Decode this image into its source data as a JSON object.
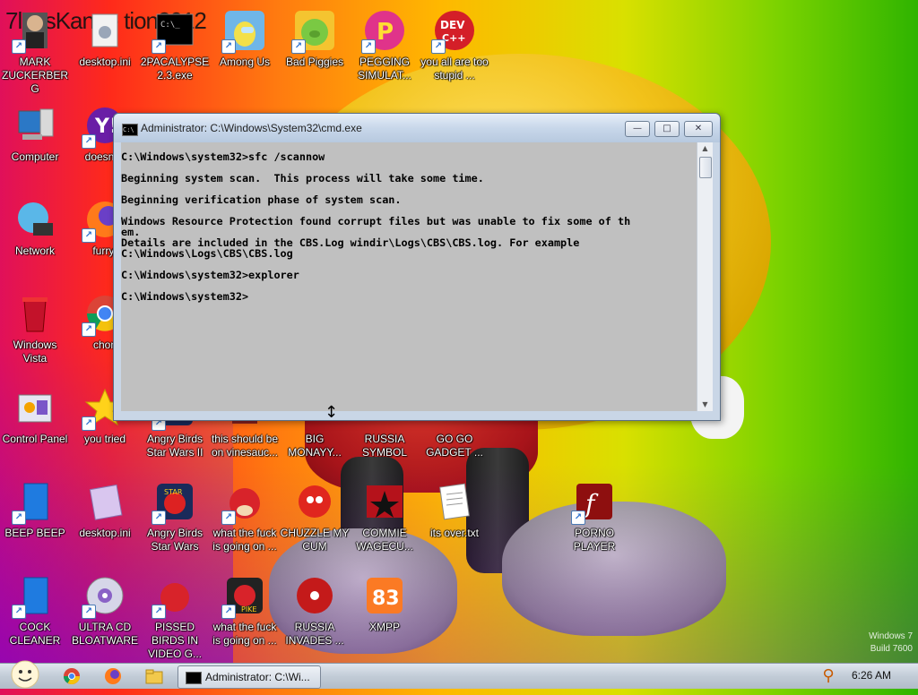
{
  "desktop": {
    "background_title": "7lossKanae tion2012",
    "watermark_line1": "Windows 7",
    "watermark_line2": "Build 7600",
    "icons": [
      {
        "label": "MARK ZUCKERBERG"
      },
      {
        "label": "desktop.ini"
      },
      {
        "label": "2PACALYPSE 2.3.exe"
      },
      {
        "label": "Among Us"
      },
      {
        "label": "Bad Piggies"
      },
      {
        "label": "PEGGING SIMULAT..."
      },
      {
        "label": "you all are too stupid ..."
      },
      {
        "label": "Computer"
      },
      {
        "label": "doesntw"
      },
      {
        "label": "Network"
      },
      {
        "label": "furryf"
      },
      {
        "label": "Windows Vista"
      },
      {
        "label": "chon"
      },
      {
        "label": "Control Panel"
      },
      {
        "label": "you tried"
      },
      {
        "label": "Angry Birds Star Wars II"
      },
      {
        "label": "this should be on vinesauc..."
      },
      {
        "label": "BIG MONAYY..."
      },
      {
        "label": "RUSSIA SYMBOL"
      },
      {
        "label": "GO GO GADGET ..."
      },
      {
        "label": "BEEP BEEP"
      },
      {
        "label": "desktop.ini"
      },
      {
        "label": "Angry Birds Star Wars"
      },
      {
        "label": "what the fuck is going on ..."
      },
      {
        "label": "CHUZZLE MY CUM"
      },
      {
        "label": "COMMIE WAGECU..."
      },
      {
        "label": "its over.txt"
      },
      {
        "label": "PORNO PLAYER"
      },
      {
        "label": "COCK CLEANER"
      },
      {
        "label": "ULTRA CD BLOATWARE"
      },
      {
        "label": "PISSED BIRDS IN VIDEO G..."
      },
      {
        "label": "what the fuck is going on ..."
      },
      {
        "label": "RUSSIA INVADES ..."
      },
      {
        "label": "XMPP"
      }
    ]
  },
  "cmd_window": {
    "title": "Administrator: C:\\Windows\\System32\\cmd.exe",
    "icon_text": "C:\\",
    "minimize_glyph": "—",
    "maximize_glyph": "□",
    "close_glyph": "✕",
    "scroll_up": "▲",
    "scroll_down": "▼",
    "console_text": "C:\\Windows\\system32>sfc /scannow\n\nBeginning system scan.  This process will take some time.\n\nBeginning verification phase of system scan.\n\nWindows Resource Protection found corrupt files but was unable to fix some of th\nem.\nDetails are included in the CBS.Log windir\\Logs\\CBS\\CBS.log. For example\nC:\\Windows\\Logs\\CBS\\CBS.log\n\nC:\\Windows\\system32>explorer\n\nC:\\Windows\\system32>"
  },
  "taskbar": {
    "task_label": "Administrator: C:\\Wi...",
    "clock": "6:26 AM",
    "search_glyph": "⚲"
  },
  "colors": {
    "console_bg": "#c0c0c0",
    "console_fg": "#000000",
    "taskbar": "#c2ccd7"
  }
}
